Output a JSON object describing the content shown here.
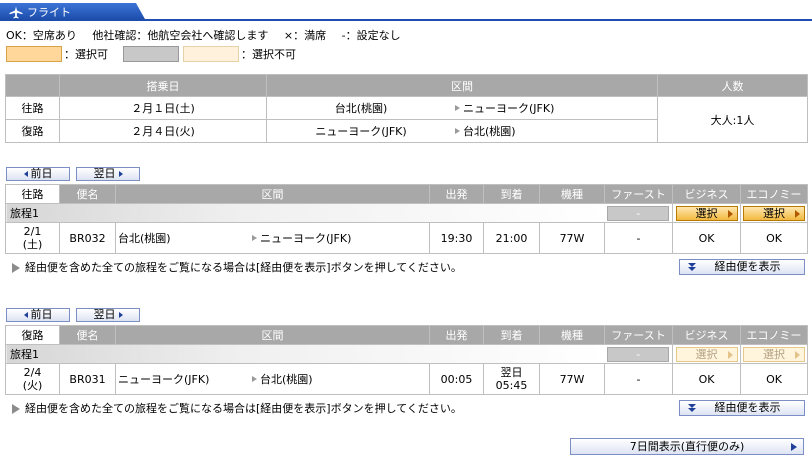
{
  "header": {
    "title": "フライト",
    "icon": "airplane-icon"
  },
  "legend": {
    "ok": "OK：空席あり",
    "other": "他社確認：他航空会社へ確認します",
    "x": "×：満席",
    "dash": "-：設定なし",
    "selectable": "：選択可",
    "unselectable": "：選択不可",
    "colors": {
      "selectable": "#ffd79a",
      "gray": "#c8c8c8",
      "unselectable": "#fff1dc"
    }
  },
  "summary": {
    "headers": {
      "date": "搭乗日",
      "route": "区間",
      "pax": "人数"
    },
    "pax": "大人:1人",
    "rows": [
      {
        "label": "往路",
        "date": "２月１日(土)",
        "from": "台北(桃園)",
        "to": "ニューヨーク(JFK)"
      },
      {
        "label": "復路",
        "date": "２月４日(火)",
        "from": "ニューヨーク(JFK)",
        "to": "台北(桃園)"
      }
    ]
  },
  "nav": {
    "prev": "前日",
    "next": "翌日"
  },
  "columns": {
    "flight": "便名",
    "route": "区間",
    "depart": "出発",
    "arrive": "到着",
    "aircraft": "機種",
    "first": "ファースト",
    "business": "ビジネス",
    "economy": "エコノミー"
  },
  "outbound": {
    "label": "往路",
    "segment": "旅程1",
    "first_slot": "-",
    "select": "選択",
    "flight": {
      "date": "2/1",
      "dow": "(土)",
      "no": "BR032",
      "from": "台北(桃園)",
      "to": "ニューヨーク(JFK)",
      "dep": "19:30",
      "arr": "21:00",
      "arr_note": "",
      "type": "77W",
      "first": "-",
      "business": "OK",
      "economy": "OK"
    }
  },
  "inbound": {
    "label": "復路",
    "segment": "旅程1",
    "first_slot": "-",
    "select": "選択",
    "flight": {
      "date": "2/4",
      "dow": "(火)",
      "no": "BR031",
      "from": "ニューヨーク(JFK)",
      "to": "台北(桃園)",
      "dep": "00:05",
      "arr_note": "翌日",
      "arr": "05:45",
      "type": "77W",
      "first": "-",
      "business": "OK",
      "economy": "OK"
    }
  },
  "note": "経由便を含めた全ての旅程をご覧になる場合は[経由便を表示]ボタンを押してください。",
  "via_button": "経由便を表示",
  "week_button": "7日間表示(直行便のみ)"
}
